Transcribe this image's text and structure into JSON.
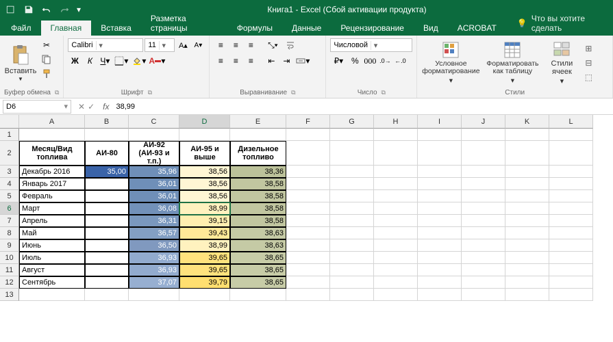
{
  "title": "Книга1 - Excel (Сбой активации продукта)",
  "tabs": {
    "file": "Файл",
    "home": "Главная",
    "insert": "Вставка",
    "layout": "Разметка страницы",
    "formulas": "Формулы",
    "data": "Данные",
    "review": "Рецензирование",
    "view": "Вид",
    "acrobat": "ACROBAT",
    "tellme": "Что вы хотите сделать"
  },
  "ribbon": {
    "paste": "Вставить",
    "clipboard": "Буфер обмена",
    "font_name": "Calibri",
    "font_size": "11",
    "font": "Шрифт",
    "align": "Выравнивание",
    "number_format": "Числовой",
    "number": "Число",
    "cond_fmt": "Условное форматирование",
    "fmt_table": "Форматировать как таблицу",
    "cell_styles": "Стили ячеек",
    "styles": "Стили"
  },
  "namebox": "D6",
  "formula": "38,99",
  "columns": [
    {
      "l": "",
      "w": 28
    },
    {
      "l": "A",
      "w": 96
    },
    {
      "l": "B",
      "w": 64
    },
    {
      "l": "C",
      "w": 74
    },
    {
      "l": "D",
      "w": 74
    },
    {
      "l": "E",
      "w": 82
    },
    {
      "l": "F",
      "w": 64
    },
    {
      "l": "G",
      "w": 64
    },
    {
      "l": "H",
      "w": 64
    },
    {
      "l": "I",
      "w": 64
    },
    {
      "l": "J",
      "w": 64
    },
    {
      "l": "K",
      "w": 64
    },
    {
      "l": "L",
      "w": 64
    }
  ],
  "active_col": "D",
  "active_row": 6,
  "row_heights": {
    "1": 18,
    "2": 36
  },
  "table": {
    "headers": {
      "A": "Месяц/Вид топлива",
      "B": "АИ-80",
      "C": "АИ-92 (АИ-93 и т.п.)",
      "D": "АИ-95 и выше",
      "E": "Дизельное топливо"
    },
    "rows": [
      {
        "A": "Декабрь 2016",
        "B": "35,00",
        "C": "35,96",
        "D": "38,56",
        "E": "38,36"
      },
      {
        "A": "Январь 2017",
        "B": "",
        "C": "36,01",
        "D": "38,56",
        "E": "38,58"
      },
      {
        "A": "Февраль",
        "B": "",
        "C": "36,01",
        "D": "38,56",
        "E": "38,58"
      },
      {
        "A": "Март",
        "B": "",
        "C": "36,08",
        "D": "38,99",
        "E": "38,58"
      },
      {
        "A": "Апрель",
        "B": "",
        "C": "36,31",
        "D": "39,15",
        "E": "38,58"
      },
      {
        "A": "Май",
        "B": "",
        "C": "36,57",
        "D": "39,43",
        "E": "38,63"
      },
      {
        "A": "Июнь",
        "B": "",
        "C": "36,50",
        "D": "38,99",
        "E": "38,63"
      },
      {
        "A": "Июль",
        "B": "",
        "C": "36,93",
        "D": "39,65",
        "E": "38,65"
      },
      {
        "A": "Август",
        "B": "",
        "C": "36,93",
        "D": "39,65",
        "E": "38,65"
      },
      {
        "A": "Сентябрь",
        "B": "",
        "C": "37,07",
        "D": "39,79",
        "E": "38,65"
      }
    ],
    "colors": {
      "B": [
        "#3a63a8"
      ],
      "C": [
        "#6f8fb8",
        "#6f8fb8",
        "#6f8fb8",
        "#7291b9",
        "#7a98be",
        "#839fc3",
        "#8099bf",
        "#92abce",
        "#92abce",
        "#97afd1"
      ],
      "D": [
        "#fff6d4",
        "#fff6d4",
        "#fff6d4",
        "#fff2bf",
        "#ffefb0",
        "#ffe998",
        "#fff2bf",
        "#ffe27d",
        "#ffe27d",
        "#ffdf70"
      ],
      "E": [
        "#bcc29a",
        "#c1c6a0",
        "#c1c6a0",
        "#c1c6a0",
        "#c1c6a0",
        "#c5caa5",
        "#c5caa5",
        "#c7cca7",
        "#c7cca7",
        "#c7cca7"
      ]
    }
  },
  "chart_data": {
    "type": "table",
    "title": "Цены на топливо по месяцам",
    "columns": [
      "Месяц/Вид топлива",
      "АИ-80",
      "АИ-92 (АИ-93 и т.п.)",
      "АИ-95 и выше",
      "Дизельное топливо"
    ],
    "rows": [
      [
        "Декабрь 2016",
        35.0,
        35.96,
        38.56,
        38.36
      ],
      [
        "Январь 2017",
        null,
        36.01,
        38.56,
        38.58
      ],
      [
        "Февраль",
        null,
        36.01,
        38.56,
        38.58
      ],
      [
        "Март",
        null,
        36.08,
        38.99,
        38.58
      ],
      [
        "Апрель",
        null,
        36.31,
        39.15,
        38.58
      ],
      [
        "Май",
        null,
        36.57,
        39.43,
        38.63
      ],
      [
        "Июнь",
        null,
        36.5,
        38.99,
        38.63
      ],
      [
        "Июль",
        null,
        36.93,
        39.65,
        38.65
      ],
      [
        "Август",
        null,
        36.93,
        39.65,
        38.65
      ],
      [
        "Сентябрь",
        null,
        37.07,
        39.79,
        38.65
      ]
    ]
  }
}
